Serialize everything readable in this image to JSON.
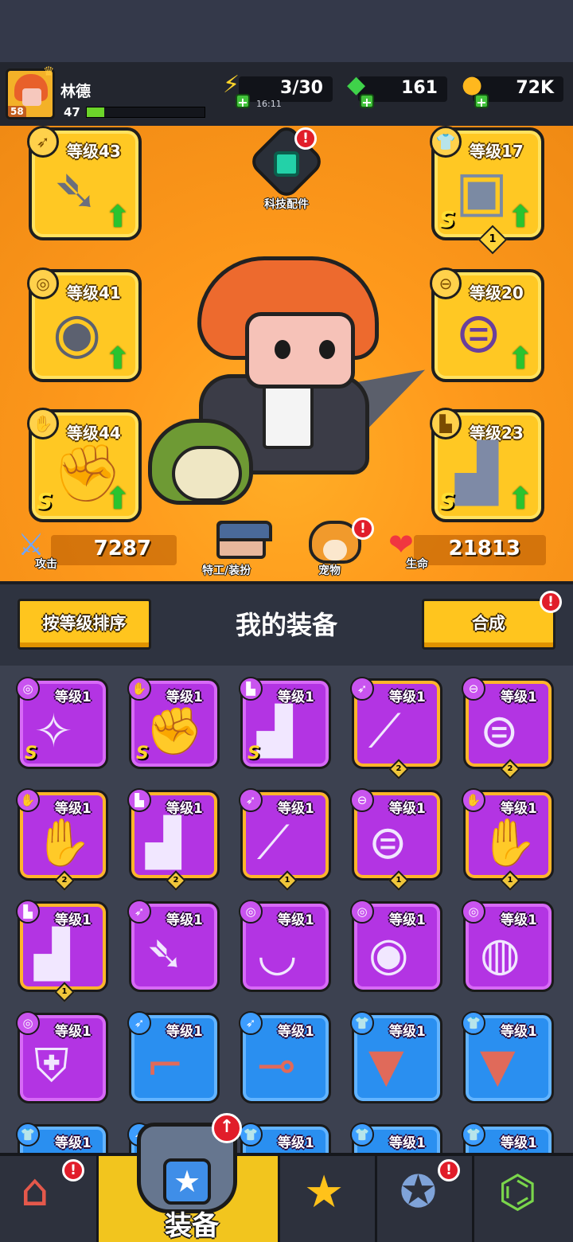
{
  "player": {
    "name": "林德",
    "level": "47",
    "avatar_level": "58",
    "xp_fraction": 0.15
  },
  "resources": {
    "energy": {
      "value": "3/30",
      "timer": "16:11",
      "icon": "lightning-icon"
    },
    "gems": {
      "value": "161",
      "icon": "green-gem-icon"
    },
    "coins": {
      "value": "72K",
      "icon": "gold-coin-icon"
    }
  },
  "equipped": {
    "weapon": {
      "label": "等级43",
      "icon": "kunai-icon"
    },
    "armor": {
      "label": "等级17",
      "icon": "armor-icon",
      "rank": "S",
      "stars": "1"
    },
    "necklace": {
      "label": "等级41",
      "icon": "spiked-collar-icon"
    },
    "belt": {
      "label": "等级20",
      "icon": "belt-icon"
    },
    "gloves": {
      "label": "等级44",
      "icon": "gauntlet-icon",
      "rank": "S"
    },
    "boots": {
      "label": "等级23",
      "icon": "boots-icon",
      "rank": "S"
    }
  },
  "tech": {
    "label": "科技配件",
    "badge": "!"
  },
  "stats": {
    "attack": {
      "label": "攻击",
      "value": "7287"
    },
    "health": {
      "label": "生命",
      "value": "21813"
    }
  },
  "shortcuts": {
    "agent": {
      "label": "特工/装扮"
    },
    "pet": {
      "label": "宠物",
      "badge": "!"
    }
  },
  "list": {
    "sort_button": "按等级排序",
    "title": "我的装备",
    "merge_button": "合成",
    "merge_badge": "!"
  },
  "items": [
    {
      "color": "purple",
      "type": "necklace",
      "level": "等级1",
      "icon": "star-ring-icon",
      "rank": "S"
    },
    {
      "color": "purple",
      "type": "gloves",
      "level": "等级1",
      "icon": "gauntlet-icon",
      "rank": "S"
    },
    {
      "color": "purple",
      "type": "boots",
      "level": "等级1",
      "icon": "boots-icon",
      "rank": "S"
    },
    {
      "color": "purple",
      "type": "weapon",
      "level": "等级1",
      "icon": "bat-icon",
      "count": "2",
      "framed": true
    },
    {
      "color": "purple",
      "type": "belt",
      "level": "等级1",
      "icon": "belt-icon",
      "count": "2",
      "framed": true
    },
    {
      "color": "purple",
      "type": "gloves",
      "level": "等级1",
      "icon": "glove-icon",
      "count": "2",
      "framed": true
    },
    {
      "color": "purple",
      "type": "boots",
      "level": "等级1",
      "icon": "boots-icon",
      "count": "2",
      "framed": true
    },
    {
      "color": "purple",
      "type": "weapon",
      "level": "等级1",
      "icon": "bat-icon",
      "count": "1",
      "framed": true
    },
    {
      "color": "purple",
      "type": "belt",
      "level": "等级1",
      "icon": "belt-icon",
      "count": "1",
      "framed": true
    },
    {
      "color": "purple",
      "type": "gloves",
      "level": "等级1",
      "icon": "glove-icon",
      "count": "1",
      "framed": true
    },
    {
      "color": "purple",
      "type": "boots",
      "level": "等级1",
      "icon": "boots-icon",
      "count": "1",
      "framed": true
    },
    {
      "color": "purple",
      "type": "weapon",
      "level": "等级1",
      "icon": "kunai-icon"
    },
    {
      "color": "purple",
      "type": "necklace",
      "level": "等级1",
      "icon": "fang-necklace-icon"
    },
    {
      "color": "purple",
      "type": "necklace",
      "level": "等级1",
      "icon": "spiked-collar-icon"
    },
    {
      "color": "purple",
      "type": "necklace",
      "level": "等级1",
      "icon": "pendant-icon"
    },
    {
      "color": "purple",
      "type": "necklace",
      "level": "等级1",
      "icon": "badge-icon"
    },
    {
      "color": "blue",
      "type": "weapon",
      "level": "等级1",
      "icon": "revolver-icon"
    },
    {
      "color": "blue",
      "type": "weapon",
      "level": "等级1",
      "icon": "shotgun-icon"
    },
    {
      "color": "blue",
      "type": "armor",
      "level": "等级1",
      "icon": "vest-icon"
    },
    {
      "color": "blue",
      "type": "armor",
      "level": "等级1",
      "icon": "vest-icon"
    },
    {
      "color": "blue",
      "type": "armor",
      "level": "等级1",
      "icon": "vest-icon"
    },
    {
      "color": "blue",
      "type": "weapon",
      "level": "",
      "icon": ""
    },
    {
      "color": "blue",
      "type": "armor",
      "level": "等级1",
      "icon": ""
    },
    {
      "color": "blue",
      "type": "armor",
      "level": "等级1",
      "icon": ""
    },
    {
      "color": "blue",
      "type": "armor",
      "level": "等级1",
      "icon": ""
    }
  ],
  "nav": {
    "shop": {
      "icon": "shop-icon",
      "badge": "!"
    },
    "equipment": {
      "label": "装备",
      "icon": "equipment-icon",
      "badge": "↑"
    },
    "talents": {
      "icon": "star-swords-icon"
    },
    "rewards": {
      "icon": "star-orb-icon",
      "badge": "!"
    },
    "lab": {
      "icon": "dna-capsule-icon"
    }
  },
  "colors": {
    "stage": "#ff9a1c",
    "slot": "#ffc823",
    "purple_card": "#b334e3",
    "blue_card": "#2a8ff0",
    "accent_green": "#41c23a",
    "badge_red": "#e11d2a"
  }
}
